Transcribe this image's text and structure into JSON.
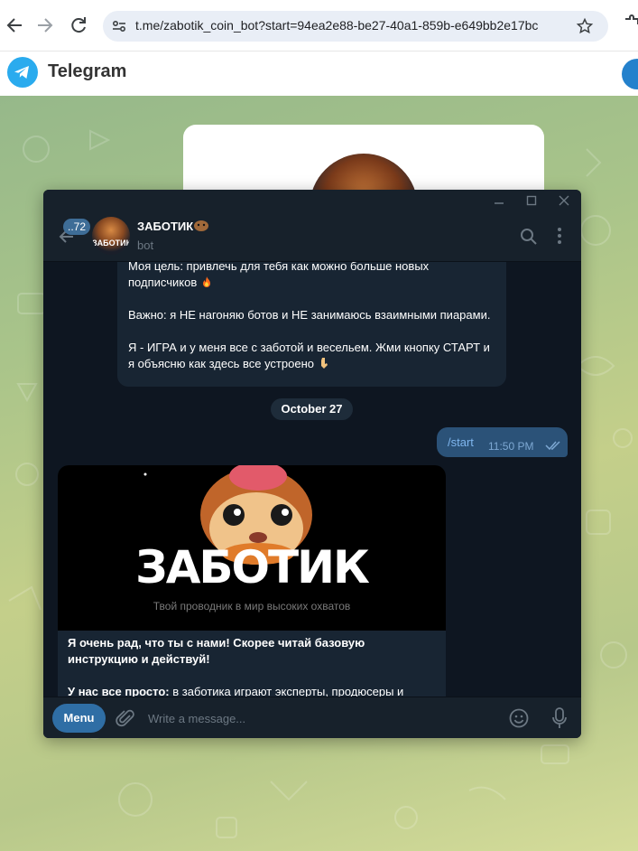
{
  "browser": {
    "url": "t.me/zabotik_coin_bot?start=94ea2e88-be27-40a1-859b-e649bb2e17bc"
  },
  "telegram_web": {
    "title": "Telegram",
    "accent_color": "#2481cc"
  },
  "window": {
    "unread_count": "..72",
    "chat_name": "ЗАБОТИК",
    "chat_status": "bot",
    "avatar_text": "ЗАБОТИК"
  },
  "messages": {
    "intro_line1": "Моя цель: привлечь для тебя как можно больше новых",
    "intro_line2": "подписчиков",
    "intro_para2": "Важно: я НЕ нагоняю ботов и НЕ занимаюсь взаимными пиарами.",
    "intro_para3": "Я - ИГРА и у меня все с заботой и весельем. Жми кнопку СТАРТ и я объясню как здесь все устроено",
    "date_separator": "October 27",
    "out_text": "/start",
    "out_time": "11:50 PM",
    "media_title": "ЗАБОТИК",
    "media_subtitle": "Твой проводник в мир высоких охватов",
    "caption_bold": "Я очень рад, что ты с нами! Скорее читай базовую инструкцию и действуй!",
    "caption_line2_bold": "У нас все просто:",
    "caption_line2_rest": " в заботика играют эксперты, продюсеры и"
  },
  "composer": {
    "menu_label": "Menu",
    "placeholder": "Write a message..."
  },
  "colors": {
    "window_bg": "#0e1621",
    "header_bg": "#17212b",
    "incoming_bubble": "#182533",
    "outgoing_bubble": "#2b5278"
  }
}
